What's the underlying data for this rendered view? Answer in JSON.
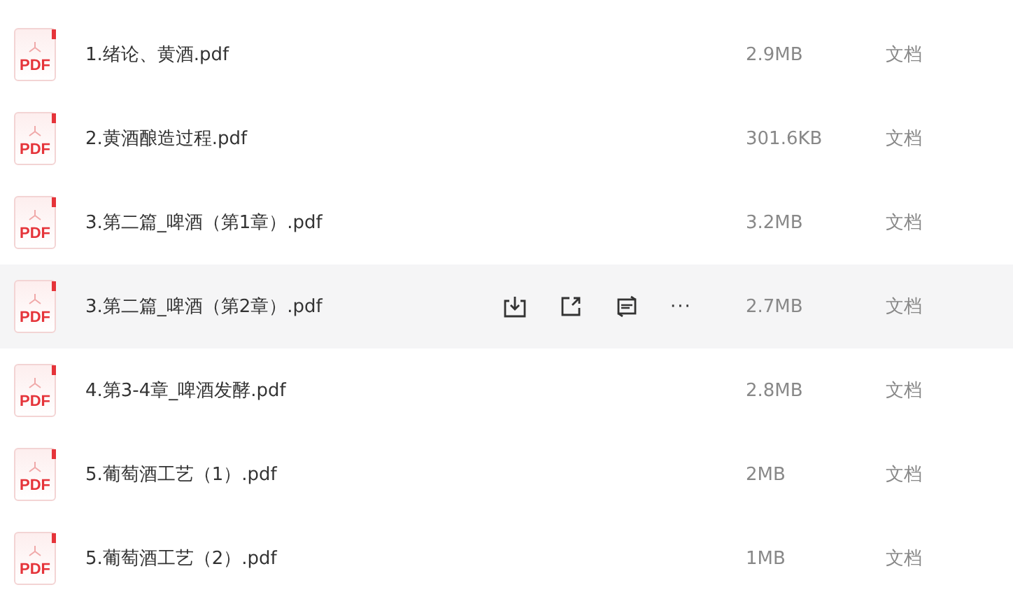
{
  "files": [
    {
      "icon_text": "PDF",
      "name": "1.绪论、黄酒.pdf",
      "size": "2.9MB",
      "type": "文档",
      "hovered": false
    },
    {
      "icon_text": "PDF",
      "name": "2.黄酒酿造过程.pdf",
      "size": "301.6KB",
      "type": "文档",
      "hovered": false
    },
    {
      "icon_text": "PDF",
      "name": "3.第二篇_啤酒（第1章）.pdf",
      "size": "3.2MB",
      "type": "文档",
      "hovered": false
    },
    {
      "icon_text": "PDF",
      "name": "3.第二篇_啤酒（第2章）.pdf",
      "size": "2.7MB",
      "type": "文档",
      "hovered": true
    },
    {
      "icon_text": "PDF",
      "name": "4.第3-4章_啤酒发酵.pdf",
      "size": "2.8MB",
      "type": "文档",
      "hovered": false
    },
    {
      "icon_text": "PDF",
      "name": "5.葡萄酒工艺（1）.pdf",
      "size": "2MB",
      "type": "文档",
      "hovered": false
    },
    {
      "icon_text": "PDF",
      "name": "5.葡萄酒工艺（2）.pdf",
      "size": "1MB",
      "type": "文档",
      "hovered": false
    }
  ],
  "more_glyph": "···"
}
